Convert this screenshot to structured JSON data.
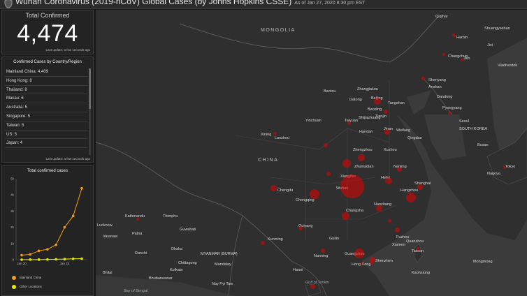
{
  "header": {
    "title": "Wuhan Coronavirus (2019-nCoV) Global Cases (by Johns Hopkins CSSE)",
    "as_of": "As of Jan 27, 2020 8:30 pm EST"
  },
  "total": {
    "label": "Total Confirmed",
    "value": "4,474",
    "updated": "Last update: a few seconds ago"
  },
  "country_panel": {
    "header": "Confirmed Cases by Country/Region",
    "rows": [
      "Mainland China: 4,409",
      "Hong Kong: 8",
      "Thailand: 8",
      "Macau: 6",
      "Australia: 5",
      "Singapore: 5",
      "Taiwan: 5",
      "US: 5",
      "Japan: 4"
    ],
    "updated": "Last update: a few seconds ago"
  },
  "chart_panel": {
    "legend": [
      {
        "label": "Mainland China",
        "color": "#f39c12"
      },
      {
        "label": "Other Locations",
        "color": "#e8e800"
      }
    ]
  },
  "chart_data": {
    "type": "line",
    "title": "Total confirmed cases",
    "x": [
      "Jan 20",
      "Jan 21",
      "Jan 22",
      "Jan 23",
      "Jan 24",
      "Jan 25",
      "Jan 26",
      "Jan 27"
    ],
    "x_tick_labels": [
      "Jan 20",
      "Jan 25"
    ],
    "y_tick_labels": [
      "0",
      "1k",
      "2k",
      "3k",
      "4k",
      "5k"
    ],
    "ylim": [
      0,
      5000
    ],
    "series": [
      {
        "name": "Mainland China",
        "color": "#f39c12",
        "values": [
          278,
          326,
          547,
          639,
          916,
          2000,
          2700,
          4409
        ]
      },
      {
        "name": "Other Locations",
        "color": "#e8e800",
        "values": [
          4,
          6,
          8,
          14,
          25,
          40,
          57,
          65
        ]
      }
    ]
  },
  "map": {
    "regions": [
      "MONGOLIA",
      "CHINA",
      "MYANMAR (BURMA)",
      "SOUTH KOREA",
      "Bay of Bengal",
      "Gulf of Tonkin",
      "Taiwan"
    ],
    "cities": [
      "Qiqihar",
      "Harbin",
      "Shuangyashan",
      "Jixi",
      "Changchun",
      "Jilin",
      "Vladivostok",
      "Shenyang",
      "Anshan",
      "Dandong",
      "Pyongyang",
      "Seoul",
      "Busan",
      "Baotou",
      "Zhangjiakou",
      "Beijing",
      "Tangshan",
      "Tianjin",
      "Datong",
      "Baoding",
      "Shijiazhuang",
      "Taiyuan",
      "Handan",
      "Jinan",
      "Weifang",
      "Qingdao",
      "Lanzhou",
      "Xining",
      "Yinchuan",
      "Zhengzhou",
      "Xuzhou",
      "Zhumadian",
      "Nanjing",
      "Shanghai",
      "Hefei",
      "Hangzhou",
      "Wuhan",
      "Xiangfan",
      "Changsha",
      "Nanchang",
      "Chengdu",
      "Chongqing",
      "Fuzhou",
      "Xiamen",
      "Quanzhou",
      "Guilin",
      "Guiyang",
      "Kunming",
      "Nanning",
      "Shenzhen",
      "Hong Kong",
      "Guangzhou",
      "Kaohsiung",
      "Kathmandu",
      "Thimphu",
      "Guwahati",
      "Patna",
      "Dhaka",
      "Chittagong",
      "Mandalay",
      "Nay Pyi Taw",
      "Hanoi",
      "Lucknow",
      "Varanasi",
      "Ranchi",
      "Bhilai",
      "Bhubaneswar",
      "Kolkata",
      "Mongmong",
      "Tokyo",
      "Nagoya"
    ]
  }
}
